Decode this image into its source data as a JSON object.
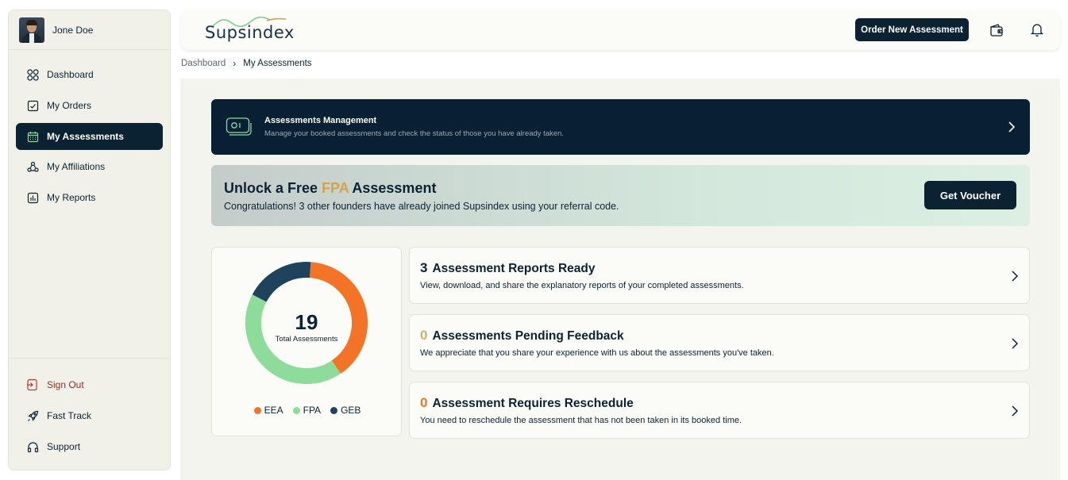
{
  "user": {
    "name": "Jone Doe"
  },
  "sidebar": {
    "items": [
      {
        "label": "Dashboard",
        "icon": "grid-icon"
      },
      {
        "label": "My Orders",
        "icon": "orders-icon"
      },
      {
        "label": "My Assessments",
        "icon": "calendar-icon",
        "active": true
      },
      {
        "label": "My Affiliations",
        "icon": "affiliations-icon"
      },
      {
        "label": "My Reports",
        "icon": "reports-icon"
      }
    ],
    "bottom_items": [
      {
        "label": "Sign Out",
        "icon": "sign-out-icon"
      },
      {
        "label": "Fast Track",
        "icon": "rocket-icon"
      },
      {
        "label": "Support",
        "icon": "headset-icon"
      }
    ]
  },
  "header": {
    "logo_text": "Supsindex",
    "order_button": "Order New Assessment"
  },
  "breadcrumb": {
    "root": "Dashboard",
    "current": "My Assessments"
  },
  "management": {
    "title": "Assessments Management",
    "subtitle": "Manage your booked assessments and check the status of those you have already taken."
  },
  "promo": {
    "title_prefix": "Unlock a Free ",
    "title_highlight": "FPA",
    "title_suffix": " Assessment",
    "subtitle": "Congratulations! 3 other founders have already joined Supsindex using your referral code.",
    "button": "Get Voucher"
  },
  "chart_data": {
    "type": "pie",
    "title": "",
    "total": "19",
    "total_label": "Total Assessments",
    "categories": [
      "EEA",
      "FPA",
      "GEB"
    ],
    "values": [
      7.5,
      8,
      3.5
    ],
    "colors": [
      "#f47427",
      "#8ddc9c",
      "#1f425d"
    ]
  },
  "stats": [
    {
      "number": "3",
      "title": "Assessment Reports Ready",
      "desc": "View, download, and share the explanatory reports of your completed assessments.",
      "number_color": "#0b2233"
    },
    {
      "number": "0",
      "title": "Assessments Pending Feedback",
      "desc": "We appreciate that you share your experience with us about the assessments you've taken.",
      "number_color": "#c9b36b"
    },
    {
      "number": "0",
      "title": "Assessment Requires Reschedule",
      "desc": "You need to reschedule the assessment that has not been taken in its booked time.",
      "number_color": "#f47427"
    }
  ],
  "colors": {
    "accent": "#0b2233",
    "background": "#f3f4ee"
  }
}
